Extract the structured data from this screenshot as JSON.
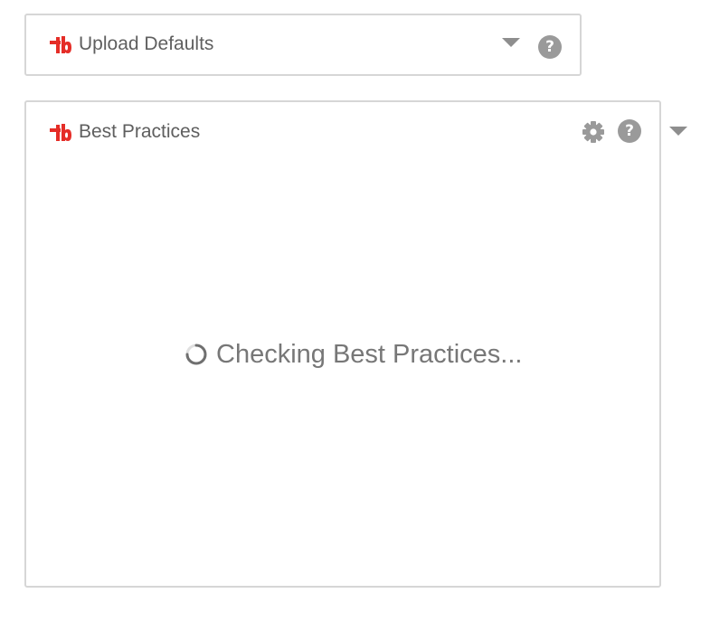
{
  "upload_defaults": {
    "title": "Upload Defaults",
    "icons": [
      "tubebuddy-logo-icon",
      "chevron-down-icon",
      "help-icon"
    ],
    "help_glyph": "?"
  },
  "best_practices": {
    "title": "Best Practices",
    "status_text": "Checking Best Practices...",
    "icons": [
      "tubebuddy-logo-icon",
      "gear-icon",
      "help-icon",
      "chevron-down-icon",
      "loading-spinner-icon"
    ],
    "help_glyph": "?"
  },
  "colors": {
    "brand_red": "#e52d27",
    "icon_gray": "#9a9a9a",
    "border": "#d6d6d6",
    "text": "#5f5f5f"
  }
}
